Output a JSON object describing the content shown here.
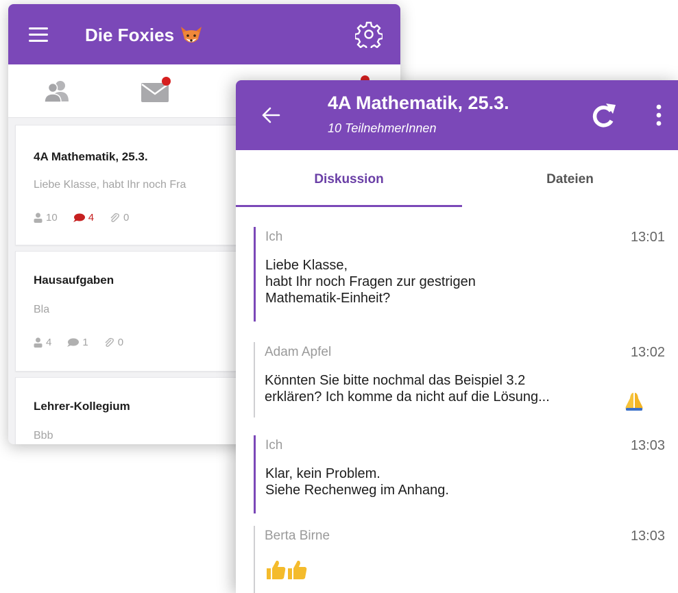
{
  "group_list": {
    "title": "Die Foxies",
    "tabs": [
      {
        "icon": "people-icon",
        "has_notification": false
      },
      {
        "icon": "mail-icon",
        "has_notification": true
      },
      {
        "icon": "third-tab-icon",
        "has_notification": true
      }
    ],
    "groups": [
      {
        "title": "4A Mathematik, 25.3.",
        "preview": "Liebe Klasse, habt Ihr noch Fra",
        "members": "10",
        "messages": "4",
        "attachments": "0",
        "messages_unread": true
      },
      {
        "title": "Hausaufgaben",
        "preview": "Bla",
        "members": "4",
        "messages": "1",
        "attachments": "0",
        "messages_unread": false
      },
      {
        "title": "Lehrer-Kollegium",
        "preview": "Bbb"
      }
    ]
  },
  "chat": {
    "title": "4A Mathematik, 25.3.",
    "subtitle": "10 TeilnehmerInnen",
    "tabs": [
      {
        "label": "Diskussion",
        "active": true
      },
      {
        "label": "Dateien",
        "active": false
      }
    ],
    "messages": [
      {
        "sender": "Ich",
        "time": "13:01",
        "text": "Liebe Klasse,\nhabt Ihr noch Fragen zur gestrigen\nMathematik-Einheit?",
        "own": true
      },
      {
        "sender": "Adam Apfel",
        "time": "13:02",
        "text": "Könnten Sie bitte nochmal das Beispiel 3.2\nerklären? Ich komme da nicht auf die Lösung...",
        "own": false,
        "emoji": "folded-hands"
      },
      {
        "sender": "Ich",
        "time": "13:03",
        "text": "Klar, kein Problem.\nSiehe Rechenweg im Anhang.",
        "own": true
      },
      {
        "sender": "Berta Birne",
        "time": "13:03",
        "text": "",
        "own": false,
        "emoji": "thumbs-up-x2"
      }
    ]
  },
  "colors": {
    "primary": "#7b48b8",
    "notification": "#d61f1f",
    "muted_text": "#a3a3a3"
  }
}
